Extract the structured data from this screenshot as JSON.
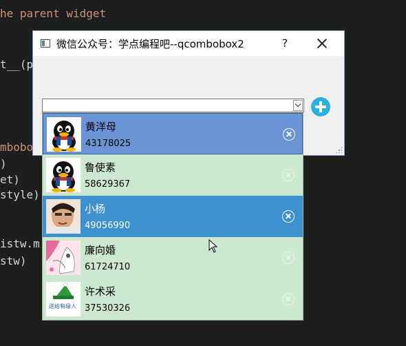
{
  "editor": {
    "lines": [
      "he parent widget",
      "t__(p",
      "mbobox",
      ")",
      "et)",
      "style)",
      "istw.m",
      "stw)"
    ]
  },
  "dialog": {
    "title": "微信公众号：学点编程吧--qcombobox2",
    "help_label": "?",
    "combo_value": ""
  },
  "dropdown": {
    "items": [
      {
        "name": "黄洋母",
        "qq": "43178025",
        "avatar": "penguin-avatar"
      },
      {
        "name": "鲁使素",
        "qq": "58629367",
        "avatar": "penguin-avatar"
      },
      {
        "name": "小杨",
        "qq": "49056990",
        "avatar": "photo-avatar"
      },
      {
        "name": "廉向婚",
        "qq": "61724710",
        "avatar": "anime-avatar"
      },
      {
        "name": "许术采",
        "qq": "37530326",
        "avatar": "hat-avatar"
      }
    ]
  },
  "colors": {
    "editor_bg": "#1e1e1e",
    "list_bg": "#cde8d1",
    "hover_row": "#6a94d6",
    "selected_row": "#3e91d1",
    "add_button": "#2cb0e0"
  }
}
